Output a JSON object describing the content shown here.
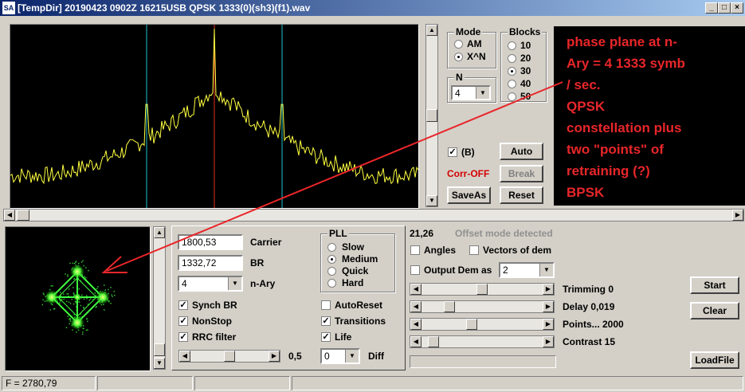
{
  "window": {
    "title": "[TempDir] 20190423 0902Z 16215USB QPSK 1333(0)(sh3)(f1).wav",
    "icon_text": "SA",
    "min_glyph": "_",
    "max_glyph": "□",
    "close_glyph": "×"
  },
  "mode": {
    "title": "Mode",
    "options": [
      "AM",
      "X^N"
    ],
    "selected": "X^N"
  },
  "n": {
    "title": "N",
    "value": "4"
  },
  "blocks": {
    "title": "Blocks",
    "options": [
      "10",
      "20",
      "30",
      "40",
      "50"
    ],
    "selected": "30"
  },
  "controls": {
    "b_label": "(B)",
    "b_checked": true,
    "corr_label": "Corr-OFF",
    "corr_color": "#d40000",
    "auto_label": "Auto",
    "break_label": "Break",
    "saveas_label": "SaveAs",
    "reset_label": "Reset"
  },
  "annotation": {
    "lines": [
      "phase plane at n-",
      "Ary = 4 1333 symb",
      "/ sec.",
      "QPSK",
      "constellation plus",
      "two \"points\" of",
      "retraining (?)",
      "BPSK"
    ],
    "color": "#e8262a"
  },
  "params": {
    "carrier_value": "1800,53",
    "carrier_label": "Carrier",
    "br_value": "1332,72",
    "br_label": "BR",
    "nary_value": "4",
    "nary_label": "n-Ary",
    "synch_label": "Synch BR",
    "synch_checked": true,
    "nonstop_label": "NonStop",
    "nonstop_checked": true,
    "rrc_label": "RRC filter",
    "rrc_checked": true,
    "rrc_value": "0,5"
  },
  "pll": {
    "title": "PLL",
    "options": [
      "Slow",
      "Medium",
      "Quick",
      "Hard"
    ],
    "selected": "Medium"
  },
  "flags": {
    "autoreset_label": "AutoReset",
    "autoreset_checked": false,
    "transitions_label": "Transitions",
    "transitions_checked": true,
    "life_label": "Life",
    "life_checked": true,
    "diff_value": "0",
    "diff_label": "Diff"
  },
  "right": {
    "value": "21,26",
    "offset_text": "Offset mode detected",
    "angles_label": "Angles",
    "vectors_label": "Vectors of dem",
    "output_label": "Output Dem as",
    "output_value": "2",
    "trimming_label": "Trimming 0",
    "delay_label": "Delay  0,019",
    "points_label": "Points... 2000",
    "contrast_label": "Contrast 15",
    "start_label": "Start",
    "clear_label": "Clear",
    "loadfile_label": "LoadFile"
  },
  "status": {
    "freq": "F = 2780,79"
  },
  "colors": {
    "spectrum_line": "#ffff40",
    "marker_cyan": "#20c0d0",
    "marker_red": "#e03020",
    "constellation": "#40ff40"
  }
}
